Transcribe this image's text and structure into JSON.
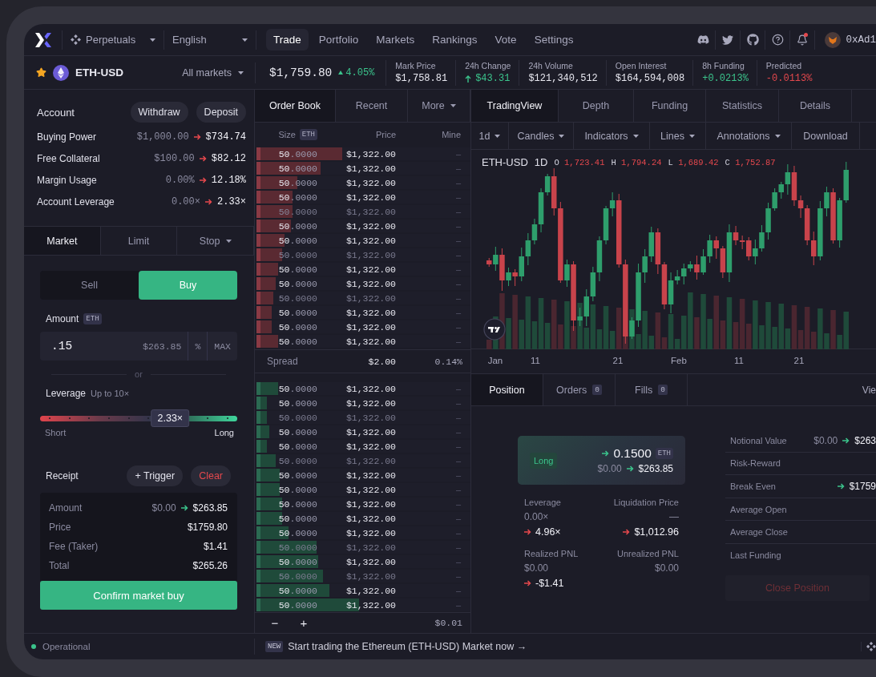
{
  "nav": {
    "product": "Perpetuals",
    "language": "English",
    "tabs": [
      {
        "label": "Trade",
        "selected": true
      },
      {
        "label": "Portfolio",
        "selected": false
      },
      {
        "label": "Markets",
        "selected": false
      },
      {
        "label": "Rankings",
        "selected": false
      },
      {
        "label": "Vote",
        "selected": false
      },
      {
        "label": "Settings",
        "selected": false
      }
    ],
    "notifications_unread": true,
    "address": "0xAd1"
  },
  "market": {
    "symbol": "ETH-USD",
    "favorite": true,
    "selector": "All markets",
    "price": "$1,759.80",
    "change": "4.05%",
    "change_positive": true,
    "stats": [
      {
        "label": "Mark Price",
        "value": "$1,758.81",
        "color": "#e8e8f0",
        "arrow": false
      },
      {
        "label": "24h Change",
        "value": "$43.31",
        "color": "#3bc48c",
        "arrow": true
      },
      {
        "label": "24h Volume",
        "value": "$121,340,512",
        "color": "#e8e8f0",
        "arrow": false
      },
      {
        "label": "Open Interest",
        "value": "$164,594,008",
        "color": "#e8e8f0",
        "arrow": false
      },
      {
        "label": "8h Funding",
        "value": "+0.0213%",
        "color": "#3bc48c",
        "arrow": false
      },
      {
        "label": "Predicted",
        "value": "-0.0113%",
        "color": "#e5484d",
        "arrow": false
      }
    ]
  },
  "account": {
    "title": "Account",
    "actions": [
      "Withdraw",
      "Deposit"
    ],
    "rows": [
      {
        "label": "Buying Power",
        "from": "$1,000.00",
        "to": "$734.74",
        "positive": false
      },
      {
        "label": "Free Collateral",
        "from": "$100.00",
        "to": "$82.12",
        "positive": false
      },
      {
        "label": "Margin Usage",
        "from": "0.00%",
        "to": "12.18%",
        "positive": false
      },
      {
        "label": "Account Leverage",
        "from": "0.00×",
        "to": "2.33×",
        "positive": false
      }
    ]
  },
  "order_form": {
    "types": [
      {
        "label": "Market",
        "selected": true,
        "dropdown": false
      },
      {
        "label": "Limit",
        "selected": false,
        "dropdown": false
      },
      {
        "label": "Stop",
        "selected": false,
        "dropdown": true
      }
    ],
    "sides": [
      {
        "label": "Sell",
        "selected": false
      },
      {
        "label": "Buy",
        "selected": true
      }
    ],
    "amount": {
      "label": "Amount",
      "unit": "ETH",
      "value": ".15",
      "usd": "$263.85",
      "percent": "%",
      "max": "MAX"
    },
    "divider": "or",
    "leverage": {
      "label": "Leverage",
      "hint": "Up to 10×",
      "level": 0.66,
      "value": "2.33×",
      "min_label": "Short",
      "max_label": "Long"
    },
    "receipt": {
      "title": "Receipt",
      "trigger": "+ Trigger",
      "clear": "Clear",
      "rows": [
        {
          "label": "Amount",
          "from": "$0.00",
          "to": "$263.85",
          "positive": true
        },
        {
          "label": "Price",
          "to": "$1759.80"
        },
        {
          "label": "Fee (Taker)",
          "to": "$1.41"
        },
        {
          "label": "Total",
          "to": "$265.26"
        }
      ]
    },
    "submit": "Confirm market buy"
  },
  "order_book": {
    "tabs": [
      {
        "label": "Order Book",
        "selected": true,
        "dropdown": false
      },
      {
        "label": "Recent",
        "selected": false,
        "dropdown": false
      },
      {
        "label": "More",
        "selected": false,
        "dropdown": true
      }
    ],
    "columns": {
      "size": "Size",
      "unit": "ETH",
      "price": "Price",
      "mine": "Mine"
    },
    "asks": [
      {
        "size": "50",
        "decimals": ".0000",
        "price": "$1,322.00",
        "mine": "–",
        "level": 0.4,
        "faded": false
      },
      {
        "size": "50",
        "decimals": ".0000",
        "price": "$1,322.00",
        "mine": "–",
        "level": 0.3,
        "faded": false
      },
      {
        "size": "50",
        "decimals": ".0000",
        "price": "$1,322.00",
        "mine": "–",
        "level": 0.19,
        "faded": false
      },
      {
        "size": "50",
        "decimals": ".0000",
        "price": "$1,322.00",
        "mine": "–",
        "level": 0.17,
        "faded": false
      },
      {
        "size": "50",
        "decimals": ".0000",
        "price": "$1,322.00",
        "mine": "–",
        "level": 0.17,
        "faded": true
      },
      {
        "size": "50",
        "decimals": ".0000",
        "price": "$1,322.00",
        "mine": "–",
        "level": 0.16,
        "faded": false
      },
      {
        "size": "50",
        "decimals": ".0000",
        "price": "$1,322.00",
        "mine": "–",
        "level": 0.13,
        "faded": false
      },
      {
        "size": "50",
        "decimals": ".0000",
        "price": "$1,322.00",
        "mine": "–",
        "level": 0.12,
        "faded": true
      },
      {
        "size": "50",
        "decimals": ".0000",
        "price": "$1,322.00",
        "mine": "–",
        "level": 0.1,
        "faded": false
      },
      {
        "size": "50",
        "decimals": ".0000",
        "price": "$1,322.00",
        "mine": "–",
        "level": 0.09,
        "faded": false
      },
      {
        "size": "50",
        "decimals": ".0000",
        "price": "$1,322.00",
        "mine": "–",
        "level": 0.08,
        "faded": true
      },
      {
        "size": "50",
        "decimals": ".0000",
        "price": "$1,322.00",
        "mine": "–",
        "level": 0.07,
        "faded": false
      },
      {
        "size": "50",
        "decimals": ".0000",
        "price": "$1,322.00",
        "mine": "–",
        "level": 0.07,
        "faded": false
      },
      {
        "size": "50",
        "decimals": ".0000",
        "price": "$1,322.00",
        "mine": "–",
        "level": 0.1,
        "faded": false
      }
    ],
    "spread": {
      "label": "Spread",
      "value": "$2.00",
      "percent": "0.14%"
    },
    "bids": [
      {
        "size": "50",
        "decimals": ".0000",
        "price": "$1,322.00",
        "mine": "–",
        "level": 0.1,
        "faded": false
      },
      {
        "size": "50",
        "decimals": ".0000",
        "price": "$1,322.00",
        "mine": "–",
        "level": 0.05,
        "faded": false
      },
      {
        "size": "50",
        "decimals": ".0000",
        "price": "$1,322.00",
        "mine": "–",
        "level": 0.05,
        "faded": true
      },
      {
        "size": "50",
        "decimals": ".0000",
        "price": "$1,322.00",
        "mine": "–",
        "level": 0.06,
        "faded": false
      },
      {
        "size": "50",
        "decimals": ".0000",
        "price": "$1,322.00",
        "mine": "–",
        "level": 0.05,
        "faded": false
      },
      {
        "size": "50",
        "decimals": ".0000",
        "price": "$1,322.00",
        "mine": "–",
        "level": 0.09,
        "faded": true
      },
      {
        "size": "50",
        "decimals": ".0000",
        "price": "$1,322.00",
        "mine": "–",
        "level": 0.11,
        "faded": false
      },
      {
        "size": "50",
        "decimals": ".0000",
        "price": "$1,322.00",
        "mine": "–",
        "level": 0.11,
        "faded": false
      },
      {
        "size": "50",
        "decimals": ".0000",
        "price": "$1,322.00",
        "mine": "–",
        "level": 0.12,
        "faded": false
      },
      {
        "size": "50",
        "decimals": ".0000",
        "price": "$1,322.00",
        "mine": "–",
        "level": 0.12,
        "faded": false
      },
      {
        "size": "50",
        "decimals": ".0000",
        "price": "$1,322.00",
        "mine": "–",
        "level": 0.15,
        "faded": false
      },
      {
        "size": "50",
        "decimals": ".0000",
        "price": "$1,322.00",
        "mine": "–",
        "level": 0.28,
        "faded": true
      },
      {
        "size": "50",
        "decimals": ".0000",
        "price": "$1,322.00",
        "mine": "–",
        "level": 0.29,
        "faded": false
      },
      {
        "size": "50",
        "decimals": ".0000",
        "price": "$1,322.00",
        "mine": "–",
        "level": 0.31,
        "faded": true
      },
      {
        "size": "50",
        "decimals": ".0000",
        "price": "$1,322.00",
        "mine": "–",
        "level": 0.34,
        "faded": false
      },
      {
        "size": "50",
        "decimals": ".0000",
        "price": "$1,322.00",
        "mine": "–",
        "level": 0.48,
        "faded": false
      }
    ],
    "footer": {
      "minus": "−",
      "plus": "+",
      "tick": "$0.01"
    }
  },
  "chart": {
    "tabs": [
      {
        "label": "TradingView",
        "selected": true
      },
      {
        "label": "Depth",
        "selected": false
      },
      {
        "label": "Funding",
        "selected": false
      },
      {
        "label": "Statistics",
        "selected": false
      },
      {
        "label": "Details",
        "selected": false
      }
    ],
    "toolbar": [
      {
        "label": "1d",
        "dropdown": true
      },
      {
        "label": "Candles",
        "dropdown": true
      },
      {
        "label": "Indicators",
        "dropdown": true
      },
      {
        "label": "Lines",
        "dropdown": true
      },
      {
        "label": "Annotations",
        "dropdown": true
      },
      {
        "label": "Download",
        "dropdown": false
      }
    ],
    "symbol": "ETH-USD",
    "interval": "1D",
    "ohlc": [
      {
        "key": "O",
        "value": "1,723.41"
      },
      {
        "key": "H",
        "value": "1,794.24"
      },
      {
        "key": "L",
        "value": "1,689.42"
      },
      {
        "key": "C",
        "value": "1,752.87"
      }
    ],
    "x_labels": [
      "Jan",
      "11",
      "21",
      "Feb",
      "11",
      "21"
    ]
  },
  "position": {
    "tabs": [
      {
        "label": "Position",
        "selected": true
      },
      {
        "label": "Orders",
        "count": "0",
        "selected": false
      },
      {
        "label": "Fills",
        "count": "0",
        "selected": false
      }
    ],
    "view_link": "Vie",
    "card": {
      "side": "Long",
      "size": "0.1500",
      "unit": "ETH",
      "size_positive": true,
      "from": "$0.00",
      "to": "$263.85",
      "positive": true
    },
    "stats": [
      {
        "label": "Leverage",
        "from": "0.00×",
        "to": "4.96×",
        "positive": false
      },
      {
        "label": "Liquidation Price",
        "from": "—",
        "to": "$1,012.96",
        "positive": false
      },
      {
        "label": "Realized PNL",
        "from": "$0.00",
        "to": "-$1.41",
        "positive": false
      },
      {
        "label": "Unrealized PNL",
        "from": "$0.00"
      }
    ],
    "details": [
      {
        "label": "Notional Value",
        "from": "$0.00",
        "to": "$263",
        "positive": true
      },
      {
        "label": "Risk-Reward"
      },
      {
        "label": "Break Even",
        "to": "$1759",
        "positive": true
      },
      {
        "label": "Average Open"
      },
      {
        "label": "Average Close"
      },
      {
        "label": "Last Funding"
      }
    ],
    "close": {
      "label": "Close Position",
      "disabled": true
    }
  },
  "status_bar": {
    "status": "Operational",
    "online": true,
    "badge": "NEW",
    "announcement": "Start trading the Ethereum (ETH-USD) Market now →"
  }
}
